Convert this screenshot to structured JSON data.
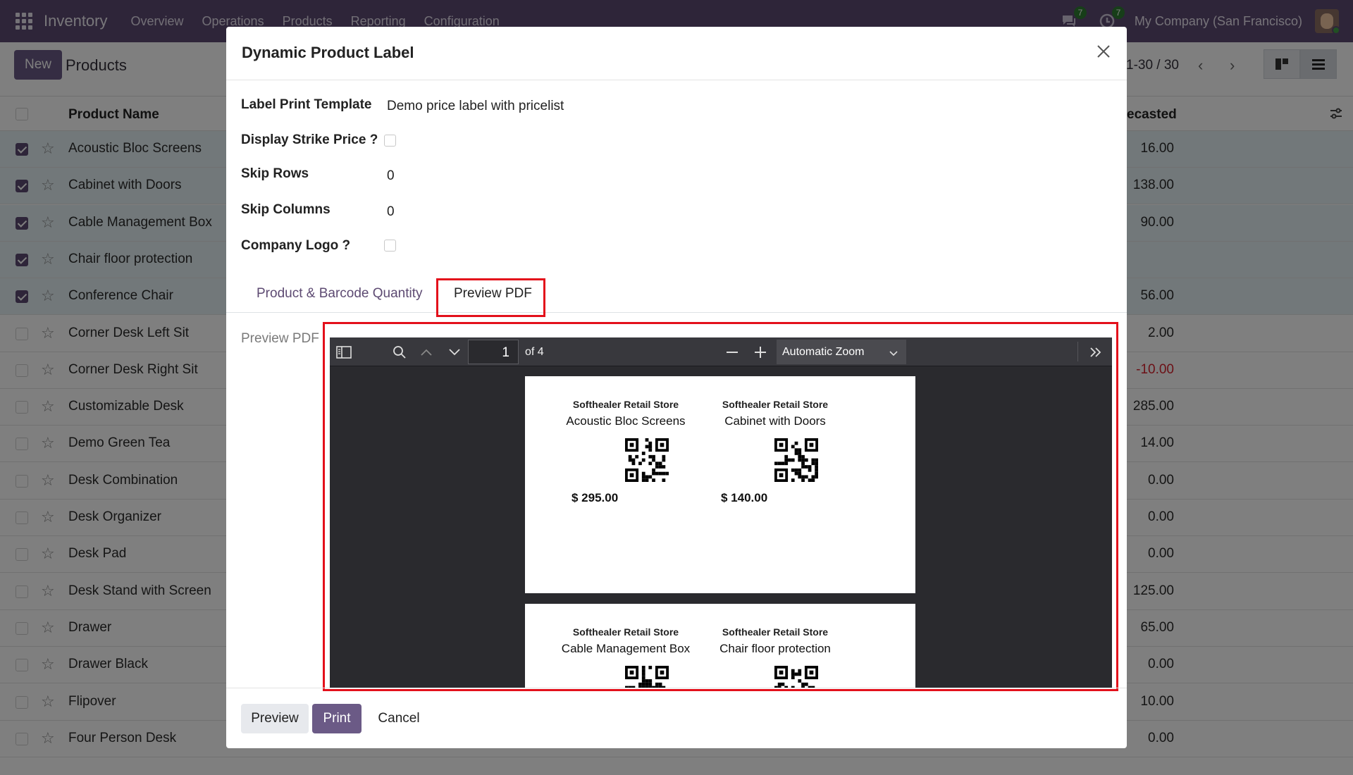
{
  "navbar": {
    "app_name": "Inventory",
    "menu": [
      "Overview",
      "Operations",
      "Products",
      "Reporting",
      "Configuration"
    ],
    "messages_badge": "7",
    "activities_badge": "7",
    "company": "My Company (San Francisco)"
  },
  "control": {
    "new_label": "New",
    "title": "Products",
    "pager": "1-30 / 30"
  },
  "list": {
    "col_name": "Product Name",
    "col_forecast_partial": "ecasted",
    "rows": [
      {
        "name": "Acoustic Bloc Screens",
        "value": "16.00",
        "selected": true
      },
      {
        "name": "Cabinet with Doors",
        "value": "138.00",
        "selected": true
      },
      {
        "name": "Cable Management Box",
        "value": "90.00",
        "selected": true
      },
      {
        "name": "Chair floor protection",
        "value": "",
        "selected": true
      },
      {
        "name": "Conference Chair",
        "value": "56.00",
        "selected": true
      },
      {
        "name": "Corner Desk Left Sit",
        "value": "2.00",
        "selected": false
      },
      {
        "name": "Corner Desk Right Sit",
        "value": "-10.00",
        "selected": false
      },
      {
        "name": "Customizable Desk",
        "value": "285.00",
        "selected": false
      },
      {
        "name": "Demo Green Tea",
        "value": "14.00",
        "selected": false
      },
      {
        "name": "Desk Combination",
        "value": "0.00",
        "selected": false
      },
      {
        "name": "Desk Organizer",
        "value": "0.00",
        "selected": false
      },
      {
        "name": "Desk Pad",
        "value": "0.00",
        "selected": false
      },
      {
        "name": "Desk Stand with Screen",
        "value": "125.00",
        "selected": false
      },
      {
        "name": "Drawer",
        "value": "65.00",
        "selected": false
      },
      {
        "name": "Drawer Black",
        "value": "0.00",
        "selected": false
      },
      {
        "name": "Flipover",
        "value": "10.00",
        "selected": false
      },
      {
        "name": "Four Person Desk",
        "value": "0.00",
        "selected": false
      }
    ]
  },
  "modal": {
    "title": "Dynamic Product Label",
    "fields": {
      "template_label": "Label Print Template",
      "template_value": "Demo price label with pricelist",
      "strike_label": "Display Strike Price ?",
      "skip_rows_label": "Skip Rows",
      "skip_rows_value": "0",
      "skip_cols_label": "Skip Columns",
      "skip_cols_value": "0",
      "logo_label": "Company Logo ?"
    },
    "tabs": [
      "Product & Barcode Quantity",
      "Preview PDF"
    ],
    "preview_label": "Preview PDF",
    "viewer": {
      "page": "1",
      "page_of": "of 4",
      "zoom": "Automatic Zoom",
      "labels": [
        {
          "store": "Softhealer Retail Store",
          "name": "Acoustic Bloc Screens",
          "price": "$ 295.00"
        },
        {
          "store": "Softhealer Retail Store",
          "name": "Cabinet with Doors",
          "price": "$ 140.00"
        },
        {
          "store": "Softhealer Retail Store",
          "name": "Cable Management Box"
        },
        {
          "store": "Softhealer Retail Store",
          "name": "Chair floor protection"
        }
      ]
    },
    "footer": {
      "preview": "Preview",
      "print": "Print",
      "cancel": "Cancel"
    }
  },
  "colors": {
    "brand": "#5d4a72",
    "highlight": "#e3101b",
    "negative": "#d9232e"
  }
}
